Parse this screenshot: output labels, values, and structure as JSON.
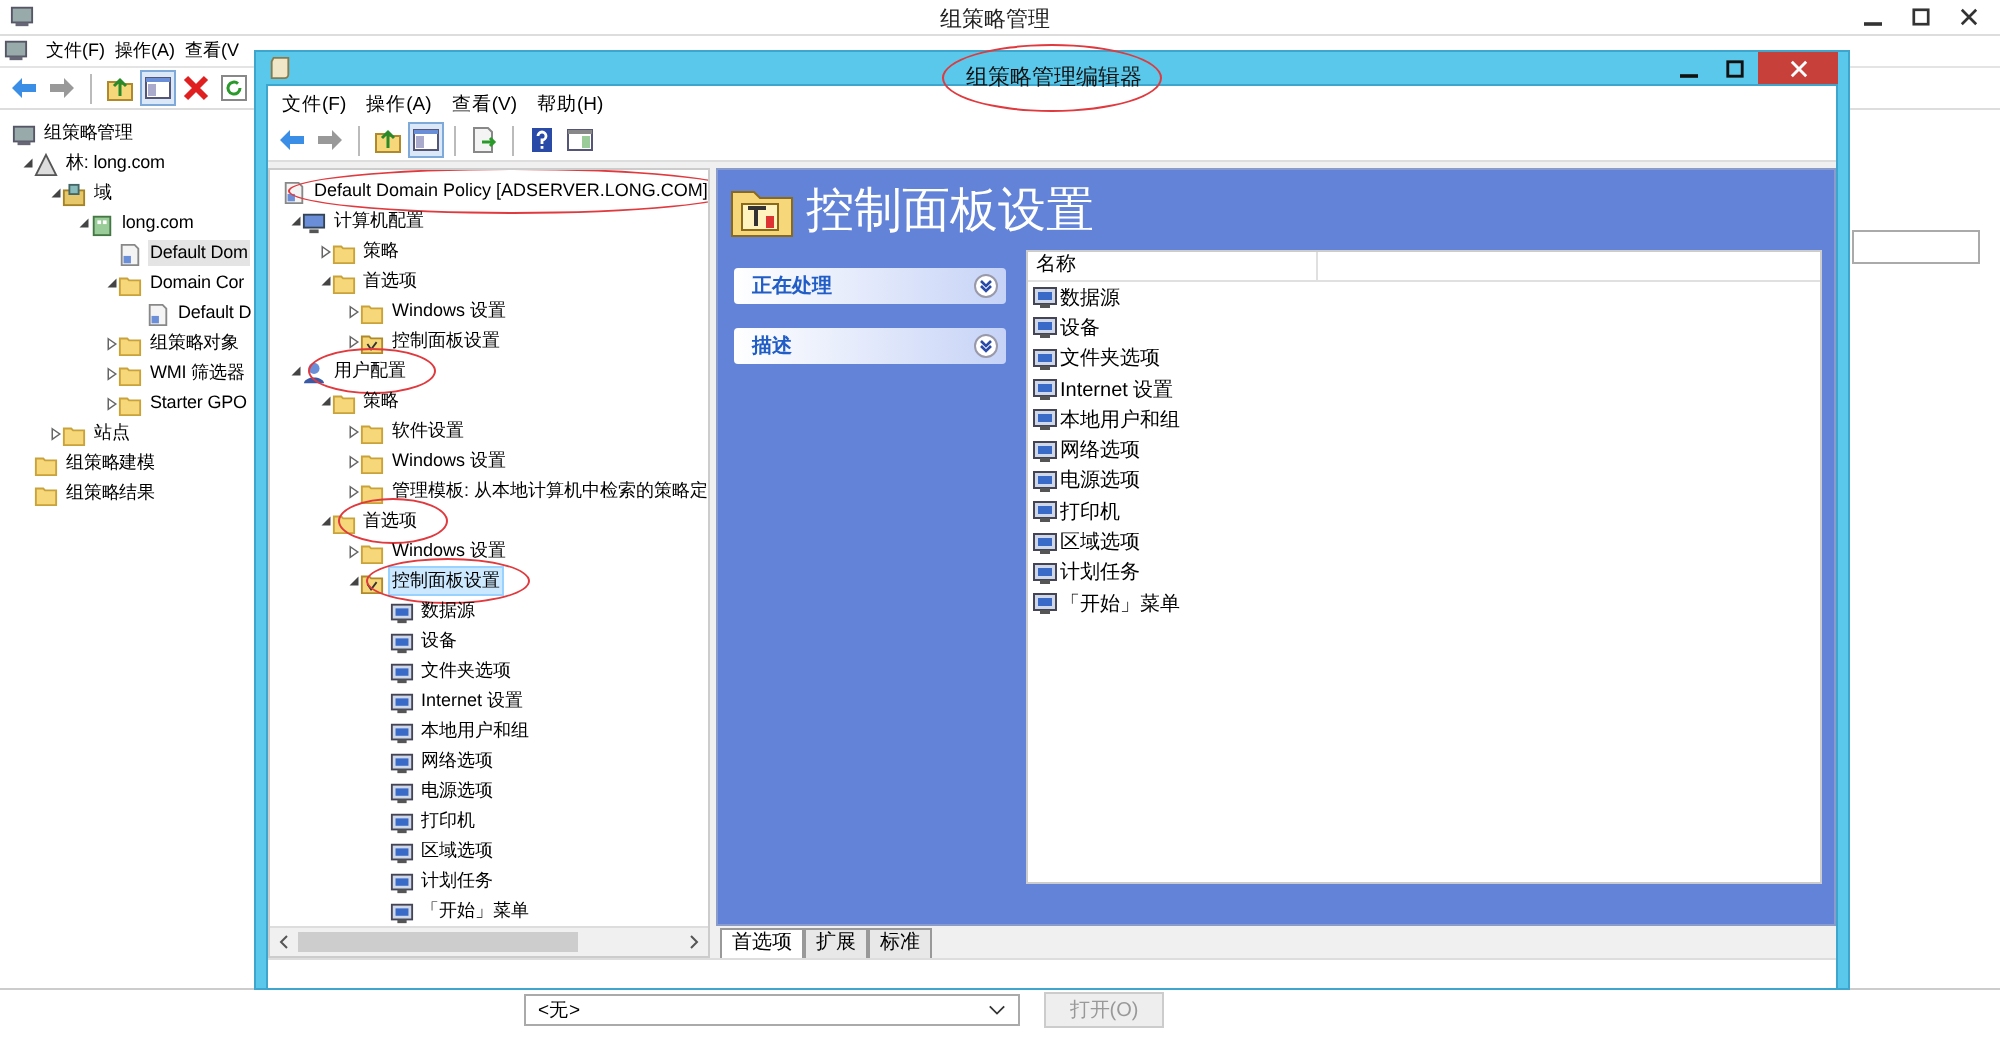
{
  "background_window": {
    "title": "组策略管理",
    "menu": [
      "文件(F)",
      "操作(A)",
      "查看(V"
    ],
    "tree": [
      {
        "label": "组策略管理",
        "kind": "console",
        "selected": false,
        "children": [
          {
            "label": "林: long.com",
            "kind": "forest",
            "expanded": true,
            "selected": false,
            "children": [
              {
                "label": "域",
                "kind": "domains",
                "expanded": true,
                "selected": false,
                "children": [
                  {
                    "label": "long.com",
                    "kind": "domain",
                    "expanded": true,
                    "selected": false,
                    "children": [
                      {
                        "label": "Default Dom",
                        "kind": "gpo",
                        "selected": true
                      },
                      {
                        "label": "Domain Cor",
                        "kind": "folder",
                        "expanded": true,
                        "selected": false,
                        "children": [
                          {
                            "label": "Default D",
                            "kind": "gpo",
                            "selected": false
                          }
                        ]
                      },
                      {
                        "label": "组策略对象",
                        "kind": "folder",
                        "expanded": false,
                        "selected": false
                      },
                      {
                        "label": "WMI 筛选器",
                        "kind": "folder",
                        "expanded": false,
                        "selected": false
                      },
                      {
                        "label": "Starter GPO",
                        "kind": "folder",
                        "expanded": false,
                        "selected": false
                      }
                    ]
                  }
                ]
              },
              {
                "label": "站点",
                "kind": "folder",
                "expanded": false,
                "selected": false
              }
            ]
          },
          {
            "label": "组策略建模",
            "kind": "folder",
            "selected": false
          },
          {
            "label": "组策略结果",
            "kind": "folder",
            "selected": false
          }
        ]
      }
    ],
    "dropdown": "<无>",
    "button": {
      "label": "打开(O)",
      "disabled": true
    }
  },
  "editor_window": {
    "title": "组策略管理编辑器",
    "title_circled": true,
    "menu": [
      "文件(F)",
      "操作(A)",
      "查看(V)",
      "帮助(H)"
    ],
    "tree": [
      {
        "label": "Default Domain Policy [ADSERVER.LONG.COM]",
        "kind": "gpo",
        "selected": false,
        "circled": true,
        "children": [
          {
            "label": "计算机配置",
            "kind": "computer",
            "expanded": true,
            "selected": false,
            "circled": false,
            "children": [
              {
                "label": "策略",
                "kind": "folder",
                "expanded": false,
                "selected": false,
                "circled": false
              },
              {
                "label": "首选项",
                "kind": "folder",
                "expanded": true,
                "selected": false,
                "circled": false,
                "children": [
                  {
                    "label": "Windows 设置",
                    "kind": "folder",
                    "expanded": false,
                    "selected": false,
                    "circled": false
                  },
                  {
                    "label": "控制面板设置",
                    "kind": "settings",
                    "expanded": false,
                    "selected": false,
                    "circled": false
                  }
                ]
              }
            ]
          },
          {
            "label": "用户配置",
            "kind": "user",
            "expanded": true,
            "selected": false,
            "circled": true,
            "children": [
              {
                "label": "策略",
                "kind": "folder",
                "expanded": true,
                "selected": false,
                "circled": false,
                "children": [
                  {
                    "label": "软件设置",
                    "kind": "folder",
                    "expanded": false,
                    "selected": false,
                    "circled": false
                  },
                  {
                    "label": "Windows 设置",
                    "kind": "folder",
                    "expanded": false,
                    "selected": false,
                    "circled": false
                  },
                  {
                    "label": "管理模板: 从本地计算机中检索的策略定",
                    "kind": "folder",
                    "expanded": false,
                    "selected": false,
                    "circled": false
                  }
                ]
              },
              {
                "label": "首选项",
                "kind": "folder",
                "expanded": true,
                "selected": false,
                "circled": true,
                "children": [
                  {
                    "label": "Windows 设置",
                    "kind": "folder",
                    "expanded": false,
                    "selected": false,
                    "circled": false
                  },
                  {
                    "label": "控制面板设置",
                    "kind": "settings",
                    "expanded": true,
                    "selected": true,
                    "circled": true,
                    "children": [
                      {
                        "label": "数据源",
                        "kind": "item",
                        "selected": false,
                        "circled": false
                      },
                      {
                        "label": "设备",
                        "kind": "item",
                        "selected": false,
                        "circled": false
                      },
                      {
                        "label": "文件夹选项",
                        "kind": "item",
                        "selected": false,
                        "circled": false
                      },
                      {
                        "label": "Internet 设置",
                        "kind": "item",
                        "selected": false,
                        "circled": false
                      },
                      {
                        "label": "本地用户和组",
                        "kind": "item",
                        "selected": false,
                        "circled": false
                      },
                      {
                        "label": "网络选项",
                        "kind": "item",
                        "selected": false,
                        "circled": false
                      },
                      {
                        "label": "电源选项",
                        "kind": "item",
                        "selected": false,
                        "circled": false
                      },
                      {
                        "label": "打印机",
                        "kind": "item",
                        "selected": false,
                        "circled": false
                      },
                      {
                        "label": "区域选项",
                        "kind": "item",
                        "selected": false,
                        "circled": false
                      },
                      {
                        "label": "计划任务",
                        "kind": "item",
                        "selected": false,
                        "circled": false
                      },
                      {
                        "label": "「开始」菜单",
                        "kind": "item",
                        "selected": false,
                        "circled": false
                      }
                    ]
                  }
                ]
              }
            ]
          }
        ]
      }
    ],
    "heading": "控制面板设置",
    "task_panels": [
      {
        "title": "正在处理",
        "expanded": false
      },
      {
        "title": "描述",
        "expanded": false
      }
    ],
    "list": {
      "columns": [
        "名称"
      ],
      "rows": [
        "数据源",
        "设备",
        "文件夹选项",
        "Internet 设置",
        "本地用户和组",
        "网络选项",
        "电源选项",
        "打印机",
        "区域选项",
        "计划任务",
        "「开始」菜单"
      ]
    },
    "tabs": [
      {
        "label": "首选项",
        "selected": true
      },
      {
        "label": "扩展",
        "selected": false
      },
      {
        "label": "标准",
        "selected": false
      }
    ]
  }
}
